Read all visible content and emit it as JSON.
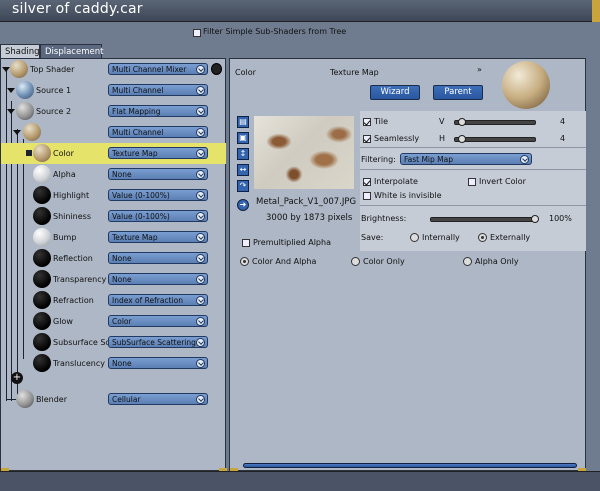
{
  "window": {
    "title": "silver of caddy.car"
  },
  "filter": {
    "label": "Filter Simple Sub-Shaders from Tree",
    "checked": false
  },
  "tabs": [
    {
      "label": "Shading",
      "active": true
    },
    {
      "label": "Displacement",
      "active": false
    }
  ],
  "tree": {
    "nodes": [
      {
        "label": "Top Shader",
        "value": "Multi Channel Mixer",
        "icon": "rust-sphere"
      },
      {
        "label": "Source 1",
        "value": "Multi Channel",
        "icon": "blue-sphere"
      },
      {
        "label": "Source 2",
        "value": "Flat Mapping",
        "icon": "gray-sphere"
      },
      {
        "label": "",
        "value": "Multi Channel",
        "icon": "rust-sphere"
      },
      {
        "label": "Color",
        "value": "Texture Map",
        "icon": "rust-sphere",
        "selected": true
      },
      {
        "label": "Alpha",
        "value": "None",
        "icon": "white-sphere"
      },
      {
        "label": "Highlight",
        "value": "Value (0-100%)",
        "icon": "black-sphere"
      },
      {
        "label": "Shininess",
        "value": "Value (0-100%)",
        "icon": "black-sphere"
      },
      {
        "label": "Bump",
        "value": "Texture Map",
        "icon": "white-sphere"
      },
      {
        "label": "Reflection",
        "value": "None",
        "icon": "black-sphere"
      },
      {
        "label": "Transparency",
        "value": "None",
        "icon": "black-sphere"
      },
      {
        "label": "Refraction",
        "value": "Index of Refraction",
        "icon": "black-sphere"
      },
      {
        "label": "Glow",
        "value": "Color",
        "icon": "black-sphere"
      },
      {
        "label": "Subsurface Sc",
        "value": "SubSurface Scattering",
        "icon": "black-sphere"
      },
      {
        "label": "Translucency",
        "value": "None",
        "icon": "black-sphere"
      }
    ],
    "blender": {
      "label": "Blender",
      "value": "Cellular",
      "icon": "gray-sphere"
    }
  },
  "right": {
    "channel": "Color",
    "shader_type": "Texture Map",
    "buttons": {
      "wizard": "Wizard",
      "parent": "Parent"
    },
    "file_name": "Metal_Pack_V1_007.JPG",
    "dimensions": "3000 by 1873 pixels",
    "premultiplied_alpha": "Premultiplied Alpha",
    "tile": {
      "label": "Tile",
      "checked": true,
      "axis": "V",
      "value": "4"
    },
    "seamlessly": {
      "label": "Seamlessly",
      "checked": true,
      "axis": "H",
      "value": "4"
    },
    "filtering": {
      "label": "Filtering:",
      "value": "Fast Mip Map"
    },
    "interpolate": {
      "label": "Interpolate",
      "checked": true
    },
    "invert_color": {
      "label": "Invert Color",
      "checked": false
    },
    "white_invisible": {
      "label": "White is invisible",
      "checked": false
    },
    "brightness": {
      "label": "Brightness:",
      "value": "100%"
    },
    "save": {
      "label": "Save:",
      "internally": "Internally",
      "externally": "Externally",
      "selected": "Externally"
    },
    "mode": {
      "options": [
        "Color And Alpha",
        "Color Only",
        "Alpha Only"
      ],
      "selected": "Color And Alpha"
    }
  }
}
